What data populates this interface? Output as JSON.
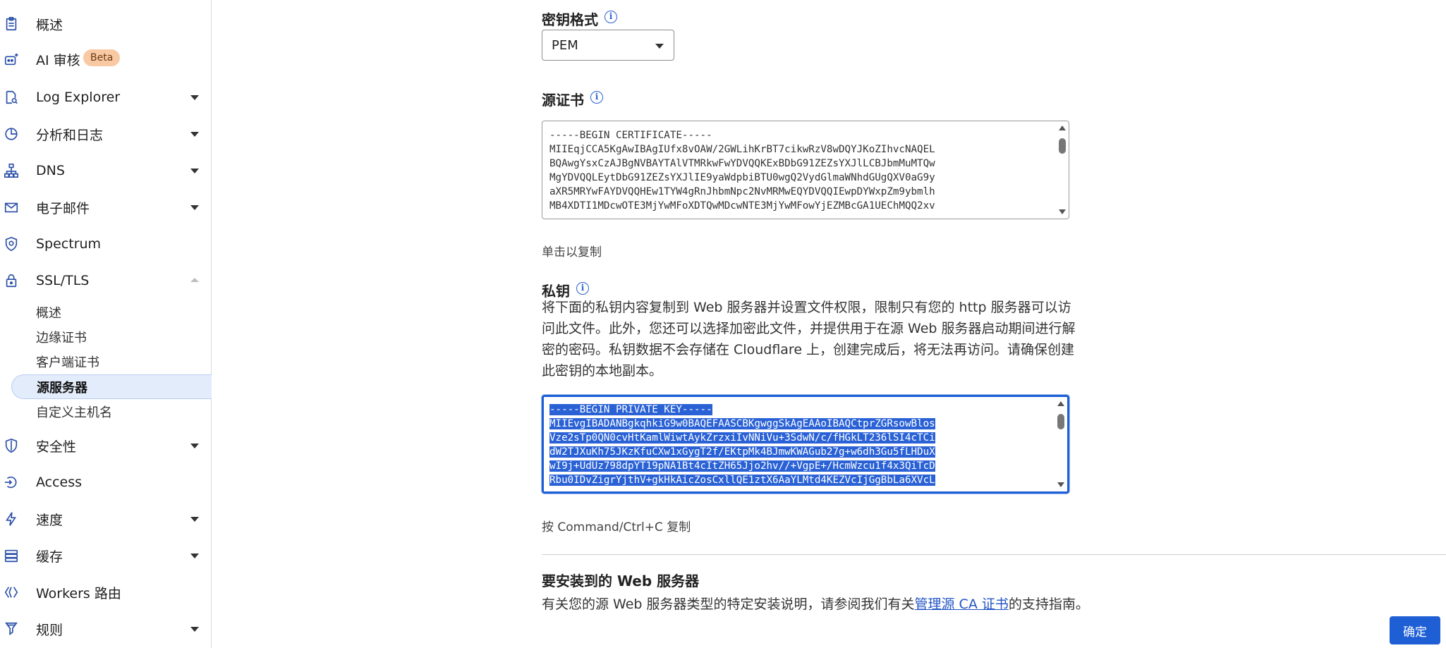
{
  "sidebar": {
    "items": [
      {
        "label": "概述",
        "icon": "clipboard-icon"
      },
      {
        "label": "AI 审核",
        "icon": "bot-icon",
        "badge": "Beta"
      },
      {
        "label": "Log Explorer",
        "icon": "log-search-icon"
      },
      {
        "label": "分析和日志",
        "icon": "pie-chart-icon"
      },
      {
        "label": "DNS",
        "icon": "network-icon"
      },
      {
        "label": "电子邮件",
        "icon": "email-icon"
      },
      {
        "label": "Spectrum",
        "icon": "shield-gear-icon"
      },
      {
        "label": "SSL/TLS",
        "icon": "lock-icon"
      },
      {
        "label": "安全性",
        "icon": "shield-icon"
      },
      {
        "label": "Access",
        "icon": "access-icon"
      },
      {
        "label": "速度",
        "icon": "lightning-icon"
      },
      {
        "label": "缓存",
        "icon": "storage-icon"
      },
      {
        "label": "Workers 路由",
        "icon": "workers-icon"
      },
      {
        "label": "规则",
        "icon": "rules-icon"
      }
    ],
    "ssl_subitems": [
      "概述",
      "边缘证书",
      "客户端证书",
      "源服务器",
      "自定义主机名"
    ]
  },
  "main": {
    "key_format": {
      "title": "密钥格式",
      "selected": "PEM"
    },
    "origin_cert": {
      "title": "源证书",
      "lines": [
        "-----BEGIN CERTIFICATE-----",
        "MIIEqjCCA5KgAwIBAgIUfx8vOAW/2GWLihKrBT7cikwRzV8wDQYJKoZIhvcNAQEL",
        "BQAwgYsxCzAJBgNVBAYTAlVTMRkwFwYDVQQKExBDbG91ZEZsYXJlLCBJbmMuMTQw",
        "MgYDVQQLEytDbG91ZEZsYXJlIE9yaWdpbiBTU0wgQ2VydGlmaWNhdGUgQXV0aG9y",
        "aXR5MRYwFAYDVQQHEw1TYW4gRnJhbmNpc2NvMRMwEQYDVQQIEwpDYWxpZm9ybmlh",
        "MB4XDTI1MDcwOTE3MjYwMFoXDTQwMDcwNTE3MjYwMFowYjEZMBcGA1UEChMQQ2xv"
      ],
      "hint": "单击以复制"
    },
    "private_key": {
      "title": "私钥",
      "description": "将下面的私钥内容复制到 Web 服务器并设置文件权限，限制只有您的 http 服务器可以访问此文件。此外，您还可以选择加密此文件，并提供用于在源 Web 服务器启动期间进行解密的密码。私钥数据不会存储在 Cloudflare 上，创建完成后，将无法再访问。请确保创建此密钥的本地副本。",
      "lines": [
        "-----BEGIN PRIVATE KEY-----",
        "MIIEvgIBADANBgkqhkiG9w0BAQEFAASCBKgwggSkAgEAAoIBAQCtprZGRsowBlos",
        "Vze2sTp0QN0cvHtKamlWiwtAykZrzxiIvNNiVu+3SdwN/c/fHGkLT236lSI4cTCi",
        "dW2TJXuKh75JKzKfuCXw1xGygT2f/EKtpMk4BJmwKWAGub27g+w6dh3Gu5fLHDuX",
        "wI9j+UdUz798dpYT19pNA1Bt4cItZH65Jjo2hv//+VgpE+/HcmWzcu1f4x3QiTcD",
        "Rbu0IDvZigrYjthV+gkHkAicZosCxllQE1ztX6AaYLMtd4KEZVcIjGgBbLa6XVcL"
      ],
      "hint": "按 Command/Ctrl+C 复制"
    },
    "install": {
      "title": "要安装到的 Web 服务器",
      "text_before": "有关您的源 Web 服务器类型的特定安装说明，请参阅我们有关",
      "link": "管理源 CA 证书",
      "text_after": "的支持指南。"
    },
    "confirm_label": "确定"
  },
  "colors": {
    "accent": "#1f5fd6",
    "badge_bg": "#f9c9a4",
    "selection": "#2a62d6"
  }
}
